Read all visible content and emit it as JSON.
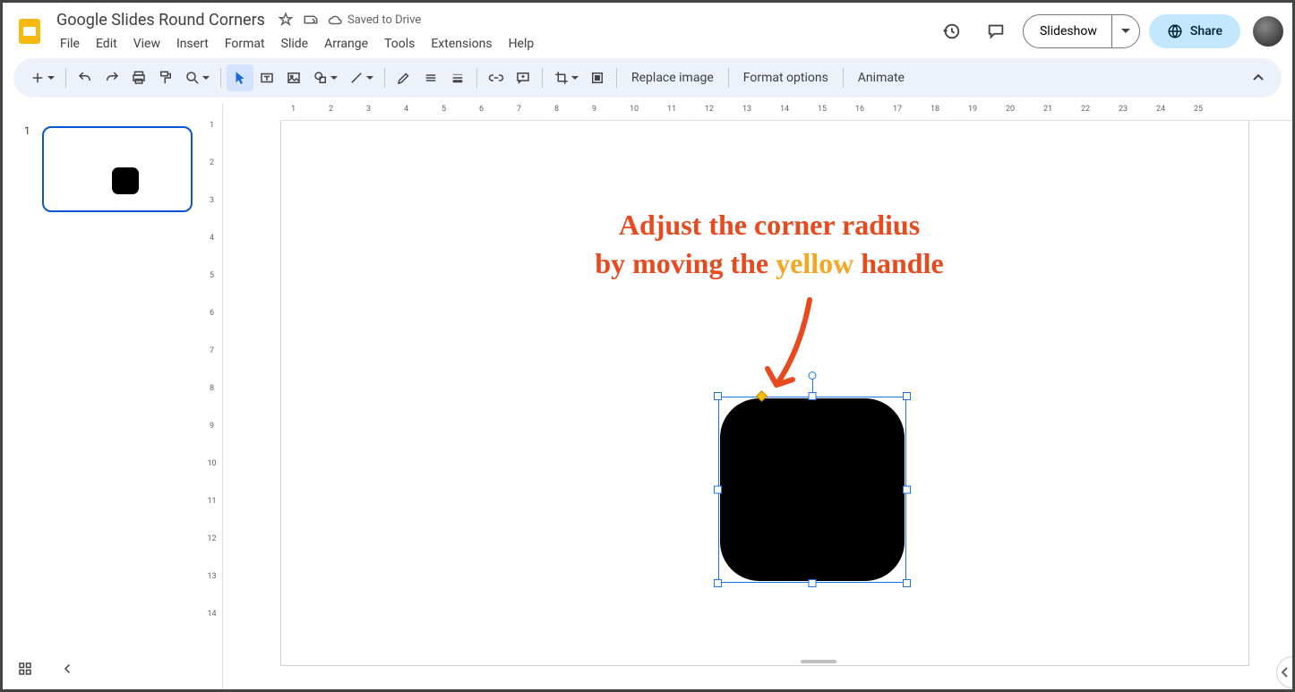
{
  "doc": {
    "title": "Google Slides Round Corners",
    "drive_status": "Saved to Drive"
  },
  "menus": [
    "File",
    "Edit",
    "View",
    "Insert",
    "Format",
    "Slide",
    "Arrange",
    "Tools",
    "Extensions",
    "Help"
  ],
  "header_buttons": {
    "slideshow": "Slideshow",
    "share": "Share"
  },
  "toolbar_text": {
    "replace_image": "Replace image",
    "format_options": "Format options",
    "animate": "Animate"
  },
  "hruler_ticks": [
    1,
    2,
    3,
    4,
    5,
    6,
    7,
    8,
    9,
    10,
    11,
    12,
    13,
    14,
    15,
    16,
    17,
    18,
    19,
    20,
    21,
    22,
    23,
    24,
    25
  ],
  "vruler_ticks": [
    1,
    2,
    3,
    4,
    5,
    6,
    7,
    8,
    9,
    10,
    11,
    12,
    13,
    14
  ],
  "filmstrip": {
    "slides": [
      {
        "number": "1"
      }
    ]
  },
  "annotation": {
    "line1": "Adjust the corner radius",
    "line2_before": "by moving the ",
    "line2_yellow": "yellow",
    "line2_after": " handle"
  },
  "selection": {
    "shape_type": "rounded-rectangle",
    "handle_color": "#1a73e8",
    "adjust_handle_color": "#fbbc04"
  }
}
